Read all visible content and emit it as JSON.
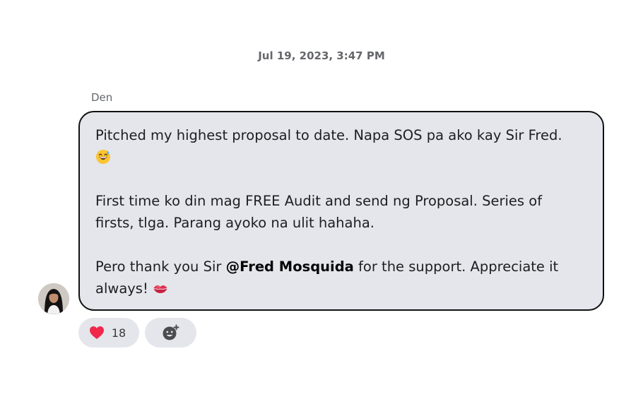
{
  "conversation": {
    "timestamp": "Jul 19, 2023, 3:47 PM"
  },
  "message": {
    "sender": "Den",
    "p1_text": "Pitched my highest proposal to date. Napa SOS pa ako kay Sir Fred.",
    "p1_emoji": "grinning-sweat-emoji",
    "p2_line1": "First time ko din mag FREE Audit and send ng Proposal. Series of",
    "p2_line2": "firsts, tlga. Parang ayoko na ulit hahaha.",
    "p3_before": "Pero thank you Sir ",
    "p3_mention": "@Fred Mosquida",
    "p3_after": " for the support. Appreciate it",
    "p3_line2": "always! ",
    "p3_emoji": "kiss-mark-emoji"
  },
  "reactions": {
    "heart_count": "18",
    "heart_icon": "red-heart-icon",
    "add_icon": "add-reaction-icon",
    "heart_color": "#f0284a"
  }
}
